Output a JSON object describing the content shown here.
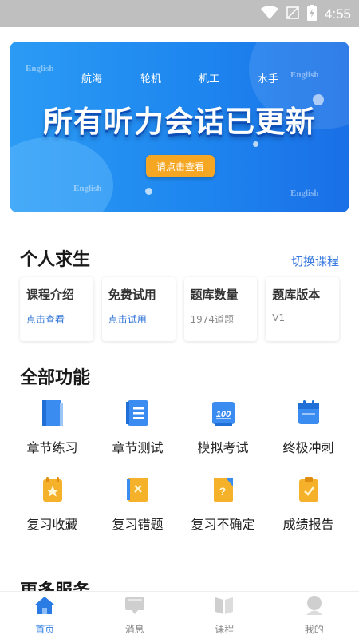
{
  "status_bar": {
    "time": "4:55",
    "icons": [
      "wifi-icon",
      "signal-icon",
      "battery-icon"
    ]
  },
  "banner": {
    "tags": [
      "航海",
      "轮机",
      "机工",
      "水手"
    ],
    "watermark": "English",
    "headline": "所有听力会话已更新",
    "cta_label": "请点击查看"
  },
  "course": {
    "title": "个人求生",
    "switch_label": "切换课程",
    "cards": [
      {
        "title": "课程介绍",
        "value": "点击查看"
      },
      {
        "title": "免费试用",
        "value": "点击试用"
      },
      {
        "title": "题库数量",
        "value": "1974道题"
      },
      {
        "title": "题库版本",
        "value": "V1"
      }
    ]
  },
  "functions": {
    "title": "全部功能",
    "items": [
      {
        "label": "章节练习",
        "icon": "book-icon"
      },
      {
        "label": "章节测试",
        "icon": "list-icon"
      },
      {
        "label": "模拟考试",
        "icon": "score-100-icon"
      },
      {
        "label": "终极冲刺",
        "icon": "calendar-icon"
      },
      {
        "label": "复习收藏",
        "icon": "star-note-icon"
      },
      {
        "label": "复习错题",
        "icon": "wrong-note-icon"
      },
      {
        "label": "复习不确定",
        "icon": "question-icon"
      },
      {
        "label": "成绩报告",
        "icon": "report-icon"
      }
    ]
  },
  "more": {
    "title": "更多服务"
  },
  "tabs": [
    {
      "label": "首页",
      "icon": "home-icon",
      "active": true
    },
    {
      "label": "消息",
      "icon": "message-icon",
      "active": false
    },
    {
      "label": "课程",
      "icon": "course-icon",
      "active": false
    },
    {
      "label": "我的",
      "icon": "profile-icon",
      "active": false
    }
  ],
  "colors": {
    "accent": "#2a7be4",
    "banner_blue": "#1e86ef",
    "cta_orange": "#f5a623",
    "icon_blue": "#3b8cf0",
    "icon_orange": "#f5b12a"
  }
}
